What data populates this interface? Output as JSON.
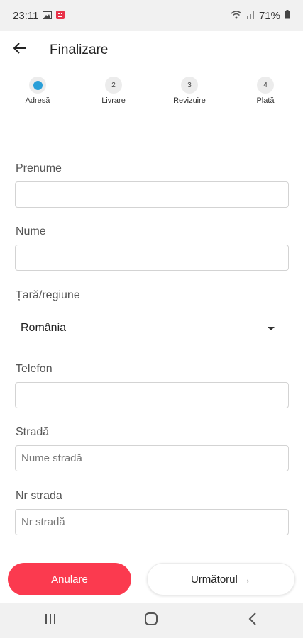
{
  "status_bar": {
    "time": "23:11",
    "battery": "71%",
    "icons": [
      "image-icon",
      "app-notification-icon",
      "wifi-icon",
      "signal-icon",
      "battery-icon"
    ]
  },
  "header": {
    "back_icon": "arrow-left-icon",
    "title": "Finalizare"
  },
  "stepper": {
    "steps": [
      {
        "number": "",
        "label": "Adresă",
        "active": true
      },
      {
        "number": "2",
        "label": "Livrare",
        "active": false
      },
      {
        "number": "3",
        "label": "Revizuire",
        "active": false
      },
      {
        "number": "4",
        "label": "Plată",
        "active": false
      }
    ],
    "active_color": "#2a9fd8"
  },
  "form": {
    "first_name": {
      "label": "Prenume",
      "value": "",
      "placeholder": ""
    },
    "last_name": {
      "label": "Nume",
      "value": "",
      "placeholder": ""
    },
    "country": {
      "label": "Țară/regiune",
      "value": "România"
    },
    "phone": {
      "label": "Telefon",
      "value": "",
      "placeholder": ""
    },
    "street": {
      "label": "Stradă",
      "value": "",
      "placeholder": "Nume stradă"
    },
    "street_number": {
      "label": "Nr strada",
      "value": "",
      "placeholder": "Nr stradă"
    }
  },
  "actions": {
    "cancel": "Anulare",
    "next": "Următorul →",
    "accent_color": "#fb3a4f"
  },
  "nav_bar": {
    "icons": [
      "recent-apps-icon",
      "home-icon",
      "back-nav-icon"
    ]
  }
}
